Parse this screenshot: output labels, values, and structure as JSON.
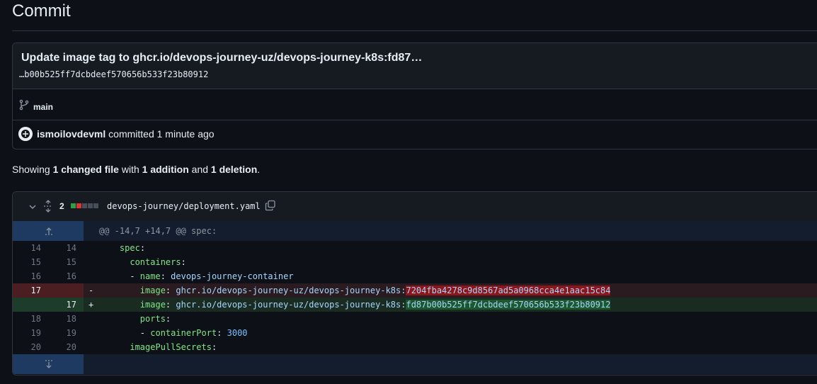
{
  "page": {
    "title": "Commit"
  },
  "commit": {
    "title": "Update image tag to ghcr.io/devops-journey-uz/devops-journey-k8s:fd87…",
    "description": "…b00b525ff7dcbdeef570656b533f23b80912",
    "branch": "main",
    "author": "ismoilovdevml",
    "committed_text": "committed 1 minute ago"
  },
  "summary": {
    "prefix": "Showing",
    "files": "1 changed file",
    "with": "with",
    "additions": "1 addition",
    "and": "and",
    "deletions": "1 deletion",
    "suffix": "."
  },
  "file": {
    "changes": "2",
    "path": "devops-journey/deployment.yaml",
    "diffstat": [
      "added",
      "deleted",
      "neutral",
      "neutral",
      "neutral"
    ]
  },
  "hunk": {
    "header": "@@ -14,7 +14,7 @@ spec:"
  },
  "lines": [
    {
      "type": "ctx",
      "old": "14",
      "new": "14",
      "sign": "",
      "indent": "    ",
      "key": "spec",
      "sep": ":",
      "val": ""
    },
    {
      "type": "ctx",
      "old": "15",
      "new": "15",
      "sign": "",
      "indent": "      ",
      "key": "containers",
      "sep": ":",
      "val": ""
    },
    {
      "type": "ctx",
      "old": "16",
      "new": "16",
      "sign": "",
      "indent": "      - ",
      "key": "name",
      "sep": ": ",
      "val": "devops-journey-container"
    },
    {
      "type": "del",
      "old": "17",
      "new": "",
      "sign": "-",
      "indent": "        ",
      "key": "image",
      "sep": ": ",
      "val": "ghcr.io/devops-journey-uz/devops-journey-k8s:",
      "hl": "7204fba4278c9d8567ad5a0968cca4e1aac15c84"
    },
    {
      "type": "add",
      "old": "",
      "new": "17",
      "sign": "+",
      "indent": "        ",
      "key": "image",
      "sep": ": ",
      "val": "ghcr.io/devops-journey-uz/devops-journey-k8s:",
      "hl": "fd87b00b525ff7dcbdeef570656b533f23b80912"
    },
    {
      "type": "ctx",
      "old": "18",
      "new": "18",
      "sign": "",
      "indent": "        ",
      "key": "ports",
      "sep": ":",
      "val": ""
    },
    {
      "type": "ctx",
      "old": "19",
      "new": "19",
      "sign": "",
      "indent": "        - ",
      "key": "containerPort",
      "sep": ": ",
      "num": "3000"
    },
    {
      "type": "ctx",
      "old": "20",
      "new": "20",
      "sign": "",
      "indent": "      ",
      "key": "imagePullSecrets",
      "sep": ":",
      "val": ""
    }
  ],
  "colors": {
    "background": "#0d1117",
    "deletion_highlight": "#8e1519",
    "addition_highlight": "#1d572d",
    "hunk_gutter": "#1f3a60"
  }
}
